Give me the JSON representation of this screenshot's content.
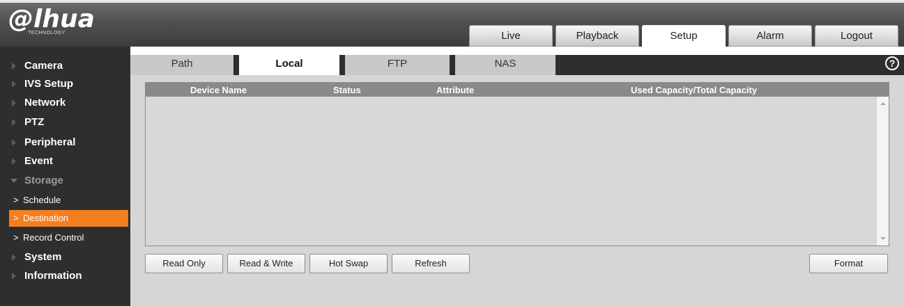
{
  "header": {
    "logo": "@lhua",
    "logo_sub": "TECHNOLOGY",
    "nav": [
      {
        "label": "Live",
        "active": false
      },
      {
        "label": "Playback",
        "active": false
      },
      {
        "label": "Setup",
        "active": true
      },
      {
        "label": "Alarm",
        "active": false
      },
      {
        "label": "Logout",
        "active": false
      }
    ]
  },
  "sidebar": {
    "items": [
      {
        "label": "Camera"
      },
      {
        "label": "IVS Setup"
      },
      {
        "label": "Network"
      },
      {
        "label": "PTZ"
      },
      {
        "label": "Peripheral"
      },
      {
        "label": "Event"
      },
      {
        "label": "Storage",
        "expanded": true
      },
      {
        "label": "System"
      },
      {
        "label": "Information"
      }
    ],
    "storage_sub": [
      {
        "label": "Schedule"
      },
      {
        "label": "Destination",
        "selected": true
      },
      {
        "label": "Record Control"
      }
    ]
  },
  "tabs": [
    {
      "label": "Path",
      "active": false
    },
    {
      "label": "Local",
      "active": true
    },
    {
      "label": "FTP",
      "active": false
    },
    {
      "label": "NAS",
      "active": false
    }
  ],
  "table": {
    "columns": [
      "Device Name",
      "Status",
      "Attribute",
      "Used Capacity/Total Capacity"
    ],
    "rows": []
  },
  "buttons": {
    "read_only": "Read Only",
    "read_write": "Read & Write",
    "hot_swap": "Hot Swap",
    "refresh": "Refresh",
    "format": "Format"
  },
  "help_symbol": "?",
  "colors": {
    "accent": "#f47f21",
    "sidebar_bg": "#2e2e2e",
    "content_bg": "#d6d6d6",
    "table_header": "#8a8a8a"
  }
}
